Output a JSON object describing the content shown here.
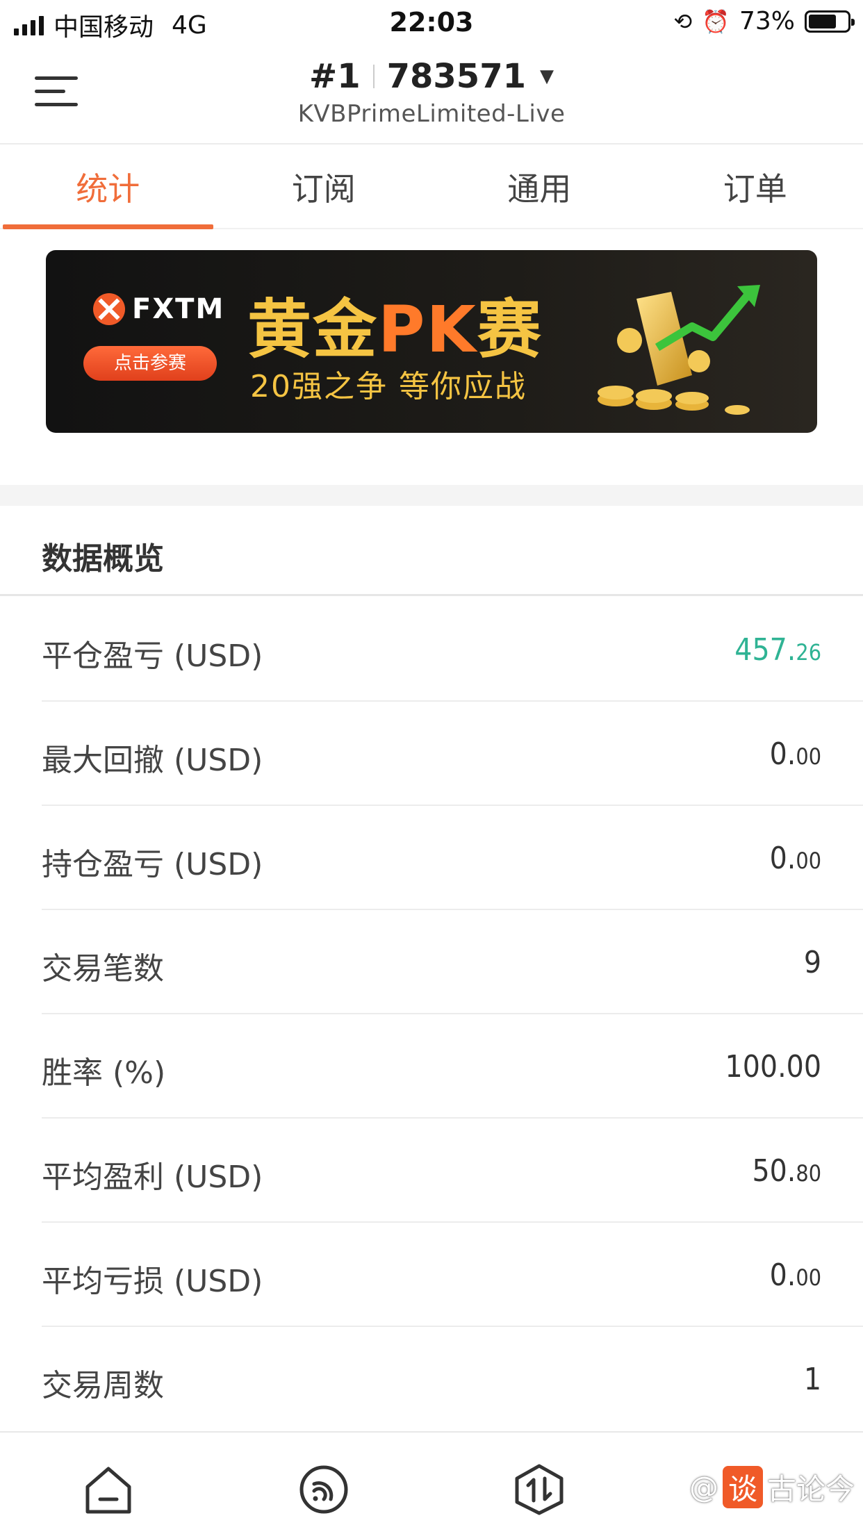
{
  "status_bar": {
    "carrier": "中国移动",
    "network": "4G",
    "time": "22:03",
    "battery": "73%",
    "battery_level": 0.73
  },
  "header": {
    "account_prefix": "#1",
    "account_number": "783571",
    "server": "KVBPrimeLimited-Live"
  },
  "tabs": [
    {
      "label": "统计",
      "active": true
    },
    {
      "label": "订阅",
      "active": false
    },
    {
      "label": "通用",
      "active": false
    },
    {
      "label": "订单",
      "active": false
    }
  ],
  "banner": {
    "brand": "FXTM",
    "button": "点击参赛",
    "title_a": "黄金",
    "title_pk": "PK",
    "title_b": "赛",
    "subtitle": "20强之争  等你应战"
  },
  "overview": {
    "title": "数据概览",
    "rows": [
      {
        "label": "平仓盈亏 (USD)",
        "int": "457.",
        "dec": "26",
        "color": "#2fb394"
      },
      {
        "label": "最大回撤 (USD)",
        "int": "0.",
        "dec": "00"
      },
      {
        "label": "持仓盈亏 (USD)",
        "int": "0.",
        "dec": "00"
      },
      {
        "label": "交易笔数",
        "int": "9",
        "dec": ""
      },
      {
        "label": "胜率 (%)",
        "int": "100.00",
        "dec": ""
      },
      {
        "label": "平均盈利 (USD)",
        "int": "50.",
        "dec": "80"
      },
      {
        "label": "平均亏损 (USD)",
        "int": "0.",
        "dec": "00"
      },
      {
        "label": "交易周数",
        "int": "1",
        "dec": ""
      }
    ]
  },
  "bottom_nav": {
    "items": [
      "home-icon",
      "signal-icon",
      "trade-icon"
    ],
    "watermark_prefix": "@",
    "watermark_badge": "谈",
    "watermark_text": "古论今"
  },
  "colors": {
    "accent": "#f06d3a",
    "positive": "#2fb394"
  }
}
